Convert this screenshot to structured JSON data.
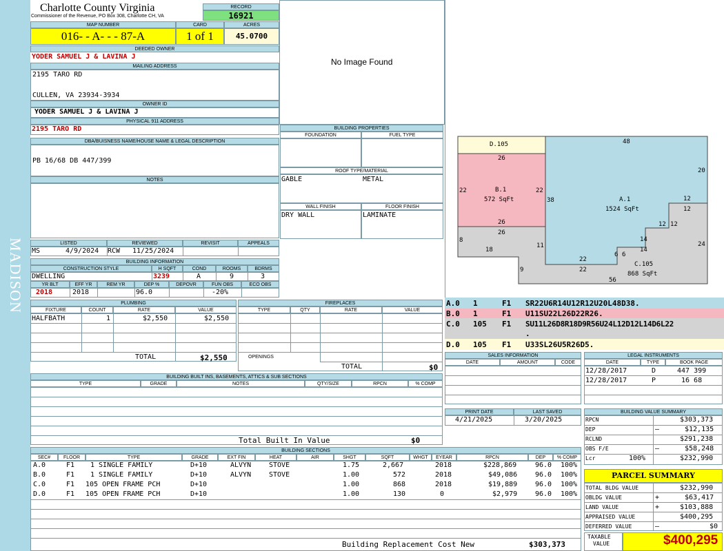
{
  "sidebar": {
    "text": "MADISON"
  },
  "county": {
    "title": "Charlotte County Virginia",
    "subtitle": "Commissioner of the Revenue, PO Box 308, Charlotte CH, VA"
  },
  "record": {
    "label": "RECORD",
    "value": "16921"
  },
  "map": {
    "label": "MAP NUMBER",
    "value": "016- - A- - - 87-A",
    "card_label": "CARD",
    "card": "1 of 1",
    "acres_label": "ACRES",
    "acres": "45.0700"
  },
  "deeded": {
    "label": "DEEDED OWNER",
    "value": "YODER SAMUEL J & LAVINA J"
  },
  "mailing": {
    "label": "MAILING ADDRESS",
    "line1": "2195 TARO RD",
    "line2": "CULLEN, VA 23934-3934"
  },
  "owner_id": {
    "label": "OWNER ID",
    "value": "YODER SAMUEL J & LAVINA J"
  },
  "physical": {
    "label": "PHYSICAL 911 ADDRESS",
    "value": "2195 TARO RD"
  },
  "dba": {
    "label": "DBA/BUISNESS NAME/HOUSE NAME & LEGAL DESCRIPTION",
    "value": "PB 16/68 DB 447/399"
  },
  "notes": {
    "label": "NOTES"
  },
  "image": {
    "text": "No Image Found"
  },
  "listed": {
    "labels": [
      "LISTED",
      "REVIEWED",
      "REVISIT",
      "APPEALS"
    ],
    "code1": "MS",
    "date1": "4/9/2024",
    "code2": "RCW",
    "date2": "11/25/2024"
  },
  "building_info": {
    "label": "BUILDING INFORMATION",
    "labels": [
      "CONSTRUCTION STYLE",
      "H SQFT",
      "COND",
      "ROOMS",
      "BDRMS"
    ],
    "style": "DWELLING",
    "hsqft": "3239",
    "cond": "A",
    "rooms": "9",
    "bdrms": "3",
    "labels2": [
      "YR BLT",
      "EFF YR",
      "REM YR",
      "DEP %",
      "DEPOVR",
      "FUN OBS",
      "ECO OBS"
    ],
    "yrblt": "2018",
    "effyr": "2018",
    "dep": "96.0",
    "funobs": "-20%"
  },
  "bldg_props": {
    "label": "BUILDING PROPERTIES",
    "foundation_label": "FOUNDATION",
    "fuel_label": "FUEL TYPE",
    "roof_label": "ROOF TYPE/MATERIAL",
    "roof_type": "GABLE",
    "roof_mat": "METAL",
    "wall_label": "WALL FINISH",
    "floor_label": "FLOOR FINISH",
    "wall": "DRY WALL",
    "floor": "LAMINATE"
  },
  "plumbing": {
    "label": "PLUMBING",
    "headers": [
      "FIXTURE",
      "COUNT",
      "RATE",
      "VALUE"
    ],
    "rows": [
      {
        "fixture": "HALFBATH",
        "count": "1",
        "rate": "$2,550",
        "value": "$2,550"
      }
    ],
    "total_label": "TOTAL",
    "total": "$2,550"
  },
  "fireplaces": {
    "label": "FIREPLACES",
    "headers": [
      "TYPE",
      "QTY",
      "RATE",
      "VALUE"
    ],
    "openings_label": "OPENINGS",
    "total_label": "TOTAL",
    "total": "$0"
  },
  "sketch": {
    "labels": [
      {
        "id": "A",
        "text": "A.1",
        "area": "1524 SqFt"
      },
      {
        "id": "B",
        "text": "B.1",
        "area": "572 SqFt"
      },
      {
        "id": "C",
        "text": "C.105",
        "area": "868 SqFt"
      },
      {
        "id": "D",
        "text": "D.105"
      }
    ],
    "dims": [
      "48",
      "20",
      "12",
      "12",
      "12",
      "12",
      "14",
      "14",
      "24",
      "6",
      "6",
      "22",
      "22",
      "56",
      "38",
      "26",
      "22",
      "22",
      "26",
      "26",
      "8",
      "18",
      "11",
      "9"
    ]
  },
  "vectors": [
    {
      "code": "A.0",
      "n": "1",
      "f": "F1",
      "v": "SR22U6R14U12R12U20L48D38."
    },
    {
      "code": "B.0",
      "n": "1",
      "f": "F1",
      "v": "U11SU22L26D22R26."
    },
    {
      "code": "C.0",
      "n": "105",
      "f": "F1",
      "v": "SU11L26D8R18D9R56U24L12D12L14D6L22",
      "v2": "."
    },
    {
      "code": "D.0",
      "n": "105",
      "f": "F1",
      "v": "U33SL26U5R26D5."
    }
  ],
  "sales": {
    "label": "SALES INFORMATION",
    "headers": [
      "DATE",
      "AMOUNT",
      "CODE"
    ]
  },
  "legal": {
    "label": "LEGAL INSTRUMENTS",
    "headers": [
      "DATE",
      "TYPE",
      "BOOK PAGE"
    ],
    "rows": [
      {
        "date": "12/28/2017",
        "type": "D",
        "book": "447 399"
      },
      {
        "date": "12/28/2017",
        "type": "P",
        "book": "16 68"
      }
    ]
  },
  "builtins": {
    "label": "BUILDING BUILT INS, BASEMENTS, ATTICS & SUB SECTIONS",
    "headers": [
      "TYPE",
      "GRADE",
      "NOTES",
      "QTY/SIZE",
      "RPCN",
      "% COMP"
    ],
    "total_label": "Total Built In Value",
    "total": "$0"
  },
  "print": {
    "print_label": "PRINT DATE",
    "saved_label": "LAST SAVED",
    "print_date": "4/21/2025",
    "saved_date": "3/20/2025"
  },
  "value_summary": {
    "label": "BUILDING VALUE SUMMARY",
    "rows": [
      {
        "label": "RPCN",
        "sign": "",
        "value": "$303,373"
      },
      {
        "label": "DEP",
        "sign": "–",
        "value": "$12,135"
      },
      {
        "label": "RCLND",
        "sign": "",
        "value": "$291,238"
      },
      {
        "label": "OBS F/E",
        "sign": "–",
        "value": "$58,248"
      },
      {
        "label": "Lcr",
        "pct": "100%",
        "sign": "",
        "value": "$232,990"
      }
    ]
  },
  "sections": {
    "label": "BUILDING SECTIONS",
    "headers": [
      "SEC#",
      "FLOOR",
      "TYPE",
      "GRADE",
      "EXT FIN",
      "HEAT",
      "AIR",
      "SHGT",
      "SQFT",
      "WHGT",
      "EYEAR",
      "RPCN",
      "DEP",
      "% COMP"
    ],
    "rows": [
      {
        "sec": "A.0",
        "floor": "F1",
        "type": "1 SINGLE FAMILY",
        "grade": "D+10",
        "ext": "ALVYN",
        "heat": "STOVE",
        "air": "",
        "shgt": "1.75",
        "sqft": "2,667",
        "whgt": "",
        "eyear": "2018",
        "rpcn": "$228,869",
        "dep": "96.0",
        "comp": "100%"
      },
      {
        "sec": "B.0",
        "floor": "F1",
        "type": "1 SINGLE FAMILY",
        "grade": "D+10",
        "ext": "ALVYN",
        "heat": "STOVE",
        "air": "",
        "shgt": "1.00",
        "sqft": "572",
        "whgt": "",
        "eyear": "2018",
        "rpcn": "$49,086",
        "dep": "96.0",
        "comp": "100%"
      },
      {
        "sec": "C.0",
        "floor": "F1",
        "type": "105 OPEN FRAME PCH",
        "grade": "D+10",
        "ext": "",
        "heat": "",
        "air": "",
        "shgt": "1.00",
        "sqft": "868",
        "whgt": "",
        "eyear": "2018",
        "rpcn": "$19,889",
        "dep": "96.0",
        "comp": "100%"
      },
      {
        "sec": "D.0",
        "floor": "F1",
        "type": "105 OPEN FRAME PCH",
        "grade": "D+10",
        "ext": "",
        "heat": "",
        "air": "",
        "shgt": "1.00",
        "sqft": "130",
        "whgt": "",
        "eyear": "0",
        "rpcn": "$2,979",
        "dep": "96.0",
        "comp": "100%"
      }
    ],
    "total_label": "Building Replacement Cost New",
    "total": "$303,373"
  },
  "parcel": {
    "label": "PARCEL SUMMARY",
    "rows": [
      {
        "label": "TOTAL BLDG VALUE",
        "sign": "",
        "value": "$232,990"
      },
      {
        "label": "OBLDG VALUE",
        "sign": "+",
        "value": "$63,417"
      },
      {
        "label": "LAND VALUE",
        "sign": "+",
        "value": "$103,888"
      },
      {
        "label": "APPRAISED VALUE",
        "sign": "",
        "value": "$400,295"
      },
      {
        "label": "DEFERRED VALUE",
        "sign": "–",
        "value": "$0"
      }
    ],
    "taxable_label1": "TAXABLE",
    "taxable_label2": "VALUE",
    "taxable": "$400,295"
  },
  "colors": {
    "header": "#b5dbe6",
    "yellow": "#ffff00",
    "green": "#7fe07f",
    "pink": "#f6b8c0",
    "gray": "#d3d3d3",
    "red": "#c00000"
  }
}
